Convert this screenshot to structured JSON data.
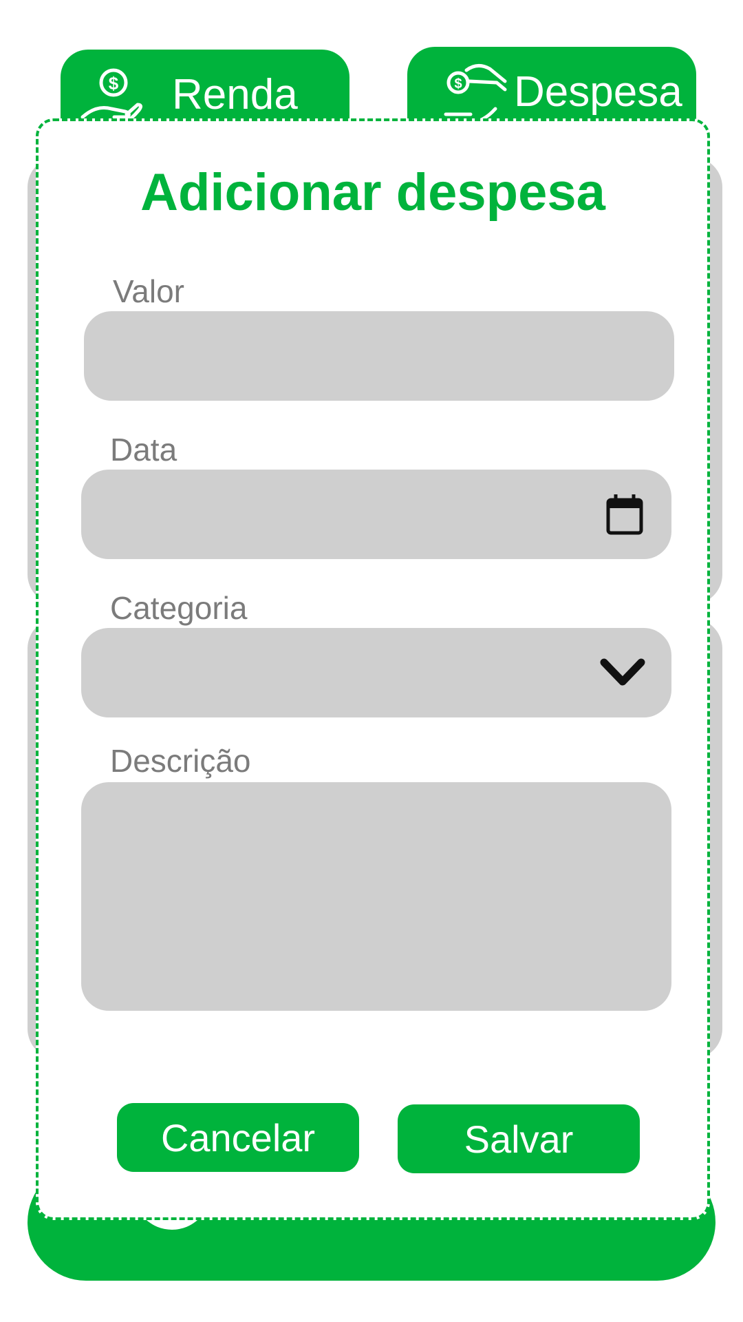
{
  "tabs": {
    "income_label": "Renda",
    "expense_label": "Despesa"
  },
  "modal": {
    "title": "Adicionar despesa",
    "fields": {
      "value_label": "Valor",
      "date_label": "Data",
      "category_label": "Categoria",
      "description_label": "Descrição"
    },
    "buttons": {
      "cancel_label": "Cancelar",
      "save_label": "Salvar"
    }
  },
  "bottom_nav": {
    "items": [
      "money-icon",
      "grid-icon",
      "user-icon"
    ]
  },
  "colors": {
    "brand_green": "#00b33c",
    "field_gray": "#cfcfcf",
    "label_gray": "#7b7b7b",
    "nav_icon_dark": "#333333"
  }
}
